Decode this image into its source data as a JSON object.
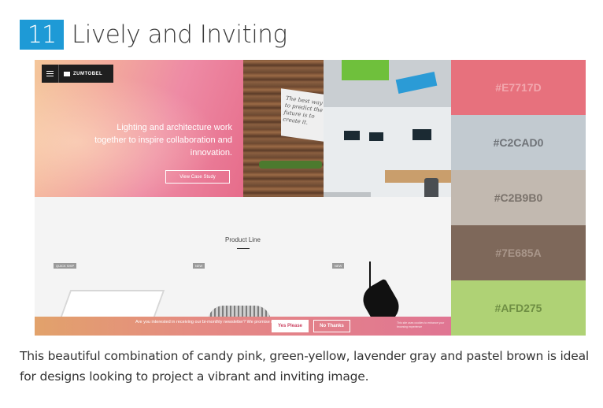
{
  "heading": {
    "number": "11",
    "title": "Lively and Inviting"
  },
  "site": {
    "brand": "ZUMTOBEL",
    "hero_text": "Lighting and architecture work together to inspire collaboration and innovation.",
    "case_button": "View Case Study",
    "photo_sign": "The best way to predict the future is to create it.",
    "product_title": "Product Line",
    "tags": [
      "QUICK SHIP",
      "NEW",
      "NEW"
    ],
    "newsletter_text": "Are you interested in receiving our bi-monthly newsletter? We promise not to spam you.",
    "yes_button": "Yes Please",
    "no_button": "No Thanks",
    "cookie_text": "This site uses cookies to enhance your browsing experience"
  },
  "palette": [
    {
      "hex": "#E7717D",
      "label": "#E7717D",
      "text_color": "#f2a7ae"
    },
    {
      "hex": "#C2CAD0",
      "label": "#C2CAD0",
      "text_color": "#6f7378"
    },
    {
      "hex": "#C2B9B0",
      "label": "#C2B9B0",
      "text_color": "#7a726b"
    },
    {
      "hex": "#7E685A",
      "label": "#7E685A",
      "text_color": "#a9968a"
    },
    {
      "hex": "#AFD275",
      "label": "#AFD275",
      "text_color": "#6f8f44"
    }
  ],
  "caption": "This beautiful combination of candy pink, green-yellow, lavender gray and pastel brown is ideal for designs looking to project a vibrant and inviting image."
}
